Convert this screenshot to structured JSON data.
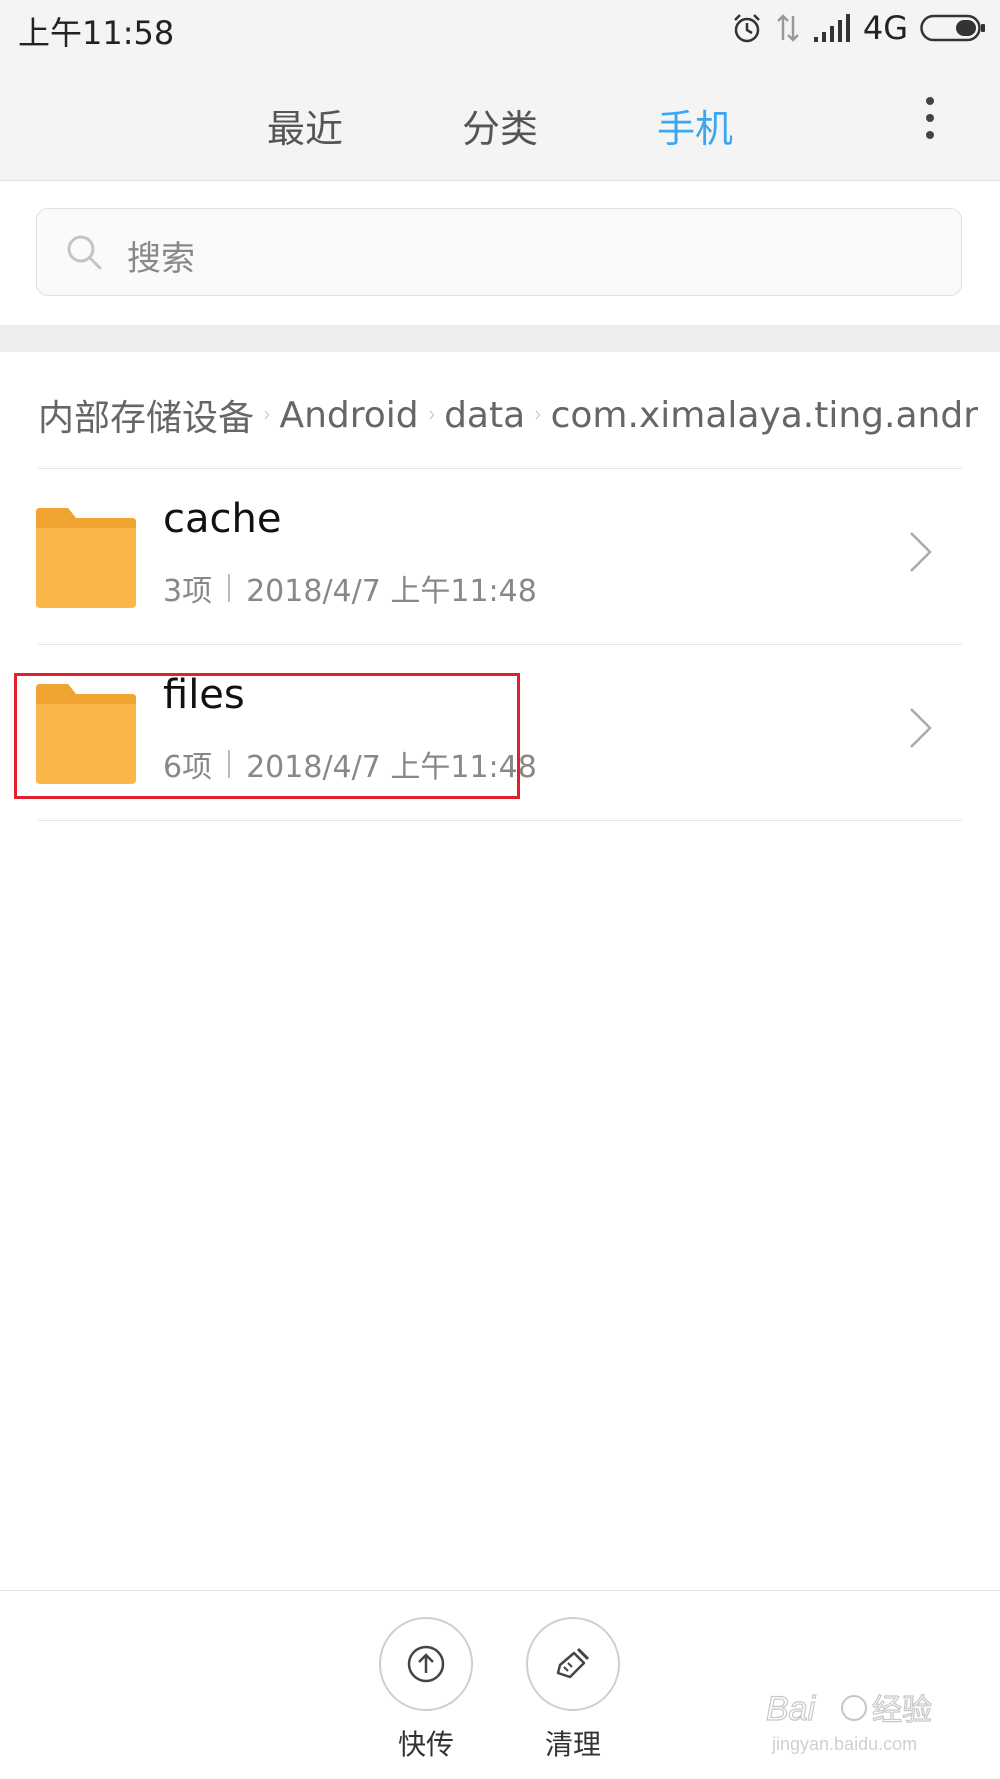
{
  "status_bar": {
    "time": "上午11:58",
    "network": "4G",
    "icons": [
      "alarm-icon",
      "data-transfer-icon",
      "signal-icon",
      "battery-icon"
    ]
  },
  "tabs": [
    {
      "label": "最近",
      "active": false
    },
    {
      "label": "分类",
      "active": false
    },
    {
      "label": "手机",
      "active": true
    }
  ],
  "search": {
    "placeholder": "搜索"
  },
  "breadcrumb": [
    "内部存储设备",
    "Android",
    "data",
    "com.ximalaya.ting.andr"
  ],
  "files": [
    {
      "name": "cache",
      "count": "3项",
      "date": "2018/4/7 上午11:48"
    },
    {
      "name": "files",
      "count": "6项",
      "date": "2018/4/7 上午11:48"
    }
  ],
  "bottom_actions": [
    {
      "label": "快传",
      "icon": "upload-icon"
    },
    {
      "label": "清理",
      "icon": "brush-icon"
    }
  ],
  "watermark": {
    "brand": "Baidu 经验",
    "url": "jingyan.baidu.com"
  },
  "colors": {
    "accent": "#3aa7f0",
    "folder": "#fbb649",
    "highlight": "#e0202a"
  }
}
